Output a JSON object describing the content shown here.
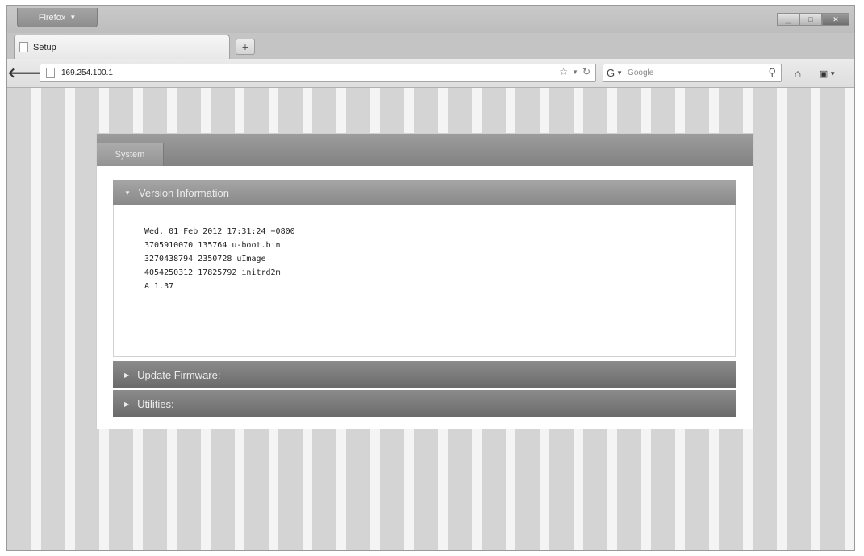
{
  "browser": {
    "app_menu_label": "Firefox",
    "tab_title": "Setup",
    "new_tab_label": "+",
    "url": "169.254.100.1",
    "search_placeholder": "Google"
  },
  "page": {
    "system_tab": "System",
    "sections": {
      "version": {
        "title": "Version Information",
        "lines": [
          "Wed, 01 Feb 2012 17:31:24 +0800",
          "3705910070 135764 u-boot.bin",
          "3270438794 2350728 uImage",
          "4054250312 17825792 initrd2m",
          "A 1.37"
        ]
      },
      "update": {
        "title": "Update Firmware:"
      },
      "utilities": {
        "title": "Utilities:"
      }
    }
  }
}
